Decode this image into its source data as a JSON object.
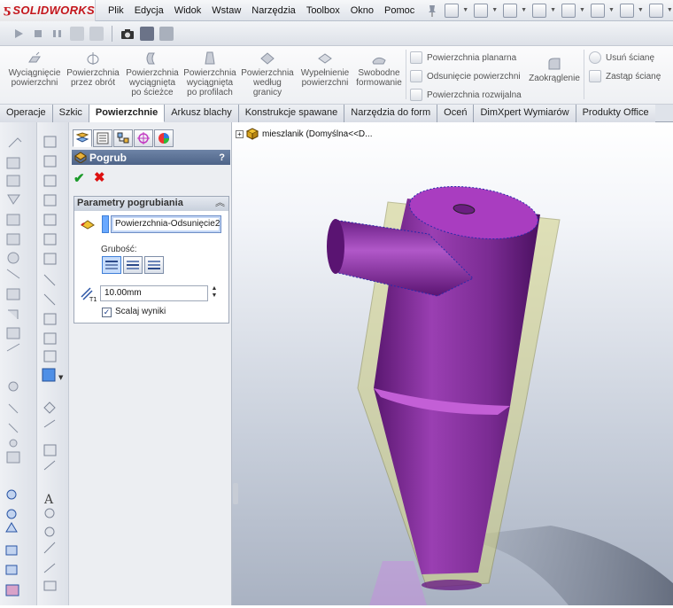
{
  "app": {
    "logo_text": "SOLIDWORKS"
  },
  "menu": [
    "Plik",
    "Edycja",
    "Widok",
    "Wstaw",
    "Narzędzia",
    "Toolbox",
    "Okno",
    "Pomoc"
  ],
  "ribbon": {
    "buttons": [
      {
        "line1": "Wyciągnięcie",
        "line2": "powierzchni",
        "line3": ""
      },
      {
        "line1": "Powierzchnia",
        "line2": "przez obrót",
        "line3": ""
      },
      {
        "line1": "Powierzchnia",
        "line2": "wyciągnięta",
        "line3": "po ścieżce"
      },
      {
        "line1": "Powierzchnia",
        "line2": "wyciągnięta",
        "line3": "po profilach"
      },
      {
        "line1": "Powierzchnia",
        "line2": "według",
        "line3": "granicy"
      },
      {
        "line1": "Wypełnienie",
        "line2": "powierzchni",
        "line3": ""
      },
      {
        "line1": "Swobodne",
        "line2": "formowanie",
        "line3": ""
      }
    ],
    "small": {
      "planar": "Powierzchnia planarna",
      "offset": "Odsunięcie powierzchni",
      "ruled": "Powierzchnia rozwijalna",
      "fillet": "Zaokrąglenie",
      "delete_face": "Usuń ścianę",
      "replace_face": "Zastąp ścianę"
    }
  },
  "tabs": [
    {
      "label": "Operacje",
      "active": false
    },
    {
      "label": "Szkic",
      "active": false
    },
    {
      "label": "Powierzchnie",
      "active": true
    },
    {
      "label": "Arkusz blachy",
      "active": false
    },
    {
      "label": "Konstrukcje spawane",
      "active": false
    },
    {
      "label": "Narzędzia do form",
      "active": false
    },
    {
      "label": "Oceń",
      "active": false
    },
    {
      "label": "DimXpert Wymiarów",
      "active": false
    },
    {
      "label": "Produkty Office",
      "active": false
    }
  ],
  "property_manager": {
    "title": "Pogrub",
    "help": "?",
    "group_title": "Parametry pogrubiania",
    "face": "Powierzchnia-Odsunięcie2",
    "thickness_label": "Grubość:",
    "thickness_value": "10.00mm",
    "merge_checkbox_label": "Scalaj wyniki",
    "merge_checked": true
  },
  "feature_tree": {
    "root": "mieszlanik  (Domyślna<<D..."
  },
  "colors": {
    "accent": "#c4161c",
    "part": "#8c2aa0",
    "thicken_preview": "#c9c98a"
  }
}
